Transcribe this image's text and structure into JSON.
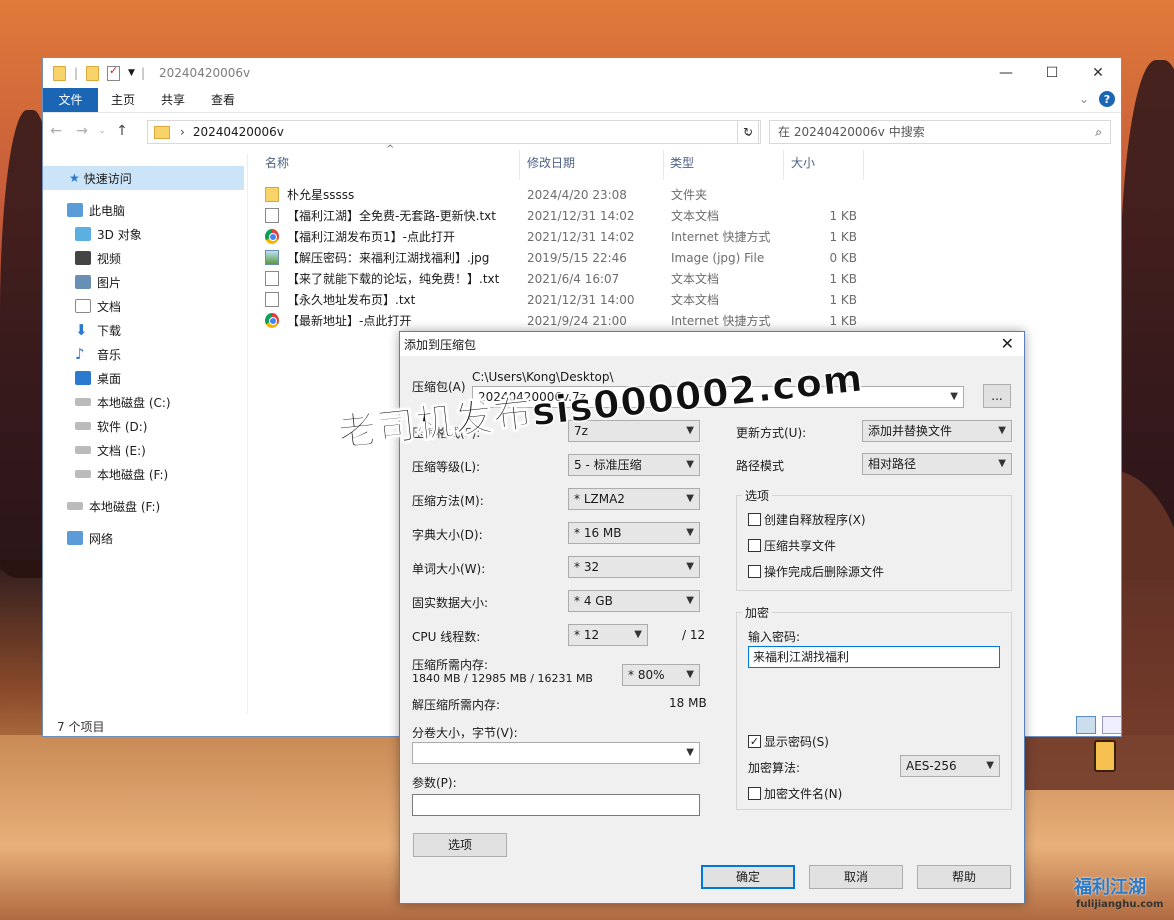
{
  "explorer": {
    "title": "20240420006v",
    "ribbon_tabs": [
      "文件",
      "主页",
      "共享",
      "查看"
    ],
    "address": "20240420006v",
    "search_placeholder": "在 20240420006v 中搜索",
    "nav": {
      "quick_access": "快速访问",
      "this_pc": "此电脑",
      "items": [
        "3D 对象",
        "视频",
        "图片",
        "文档",
        "下载",
        "音乐",
        "桌面",
        "本地磁盘 (C:)",
        "软件 (D:)",
        "文档 (E:)",
        "本地磁盘 (F:)"
      ],
      "drive_f": "本地磁盘 (F:)",
      "network": "网络"
    },
    "columns": {
      "name": "名称",
      "date": "修改日期",
      "type": "类型",
      "size": "大小"
    },
    "files": [
      {
        "icon": "folder",
        "name": "朴允星sssss",
        "date": "2024/4/20 23:08",
        "type": "文件夹",
        "size": ""
      },
      {
        "icon": "txt",
        "name": "【福利江湖】全免费-无套路-更新快.txt",
        "date": "2021/12/31 14:02",
        "type": "文本文档",
        "size": "1 KB"
      },
      {
        "icon": "url",
        "name": "【福利江湖发布页1】-点此打开",
        "date": "2021/12/31 14:02",
        "type": "Internet 快捷方式",
        "size": "1 KB"
      },
      {
        "icon": "img",
        "name": "【解压密码：来福利江湖找福利】.jpg",
        "date": "2019/5/15 22:46",
        "type": "Image (jpg) File",
        "size": "0 KB"
      },
      {
        "icon": "txt",
        "name": "【来了就能下载的论坛，纯免费！】.txt",
        "date": "2021/6/4 16:07",
        "type": "文本文档",
        "size": "1 KB"
      },
      {
        "icon": "txt",
        "name": "【永久地址发布页】.txt",
        "date": "2021/12/31 14:00",
        "type": "文本文档",
        "size": "1 KB"
      },
      {
        "icon": "url",
        "name": "【最新地址】-点此打开",
        "date": "2021/9/24 21:00",
        "type": "Internet 快捷方式",
        "size": "1 KB"
      }
    ],
    "status": "7 个项目"
  },
  "dialog": {
    "title": "添加到压缩包",
    "archive_label": "压缩包(A)",
    "archive_path": "C:\\Users\\Kong\\Desktop\\",
    "archive_name": "20240420006v.7z",
    "browse": "...",
    "format_label": "压缩格式(F):",
    "format_value": "7z",
    "level_label": "压缩等级(L):",
    "level_value": "5 - 标准压缩",
    "method_label": "压缩方法(M):",
    "method_value": "* LZMA2",
    "dict_label": "字典大小(D):",
    "dict_value": "* 16 MB",
    "word_label": "单词大小(W):",
    "word_value": "* 32",
    "solid_label": "固实数据大小:",
    "solid_value": "* 4 GB",
    "cpu_label": "CPU 线程数:",
    "cpu_value": "* 12",
    "cpu_total": "/ 12",
    "mem_label": "压缩所需内存:",
    "mem_value": "1840 MB / 12985 MB / 16231 MB",
    "mem_percent": "* 80%",
    "decomp_label": "解压缩所需内存:",
    "decomp_value": "18 MB",
    "split_label": "分卷大小，字节(V):",
    "params_label": "参数(P):",
    "options_btn": "选项",
    "update_label": "更新方式(U):",
    "update_value": "添加并替换文件",
    "path_label": "路径模式",
    "path_value": "相对路径",
    "options_group": "选项",
    "opt_sfx": "创建自释放程序(X)",
    "opt_shared": "压缩共享文件",
    "opt_delete": "操作完成后删除源文件",
    "encrypt_group": "加密",
    "pwd_label": "输入密码:",
    "pwd_value": "来福利江湖找福利",
    "show_pwd": "显示密码(S)",
    "enc_method_label": "加密算法:",
    "enc_method_value": "AES-256",
    "enc_names": "加密文件名(N)",
    "ok": "确定",
    "cancel": "取消",
    "help": "帮助"
  },
  "watermark": "老司机发布sis000002.com",
  "logo": "福利江湖",
  "logo_url": "fulijianghu.com"
}
